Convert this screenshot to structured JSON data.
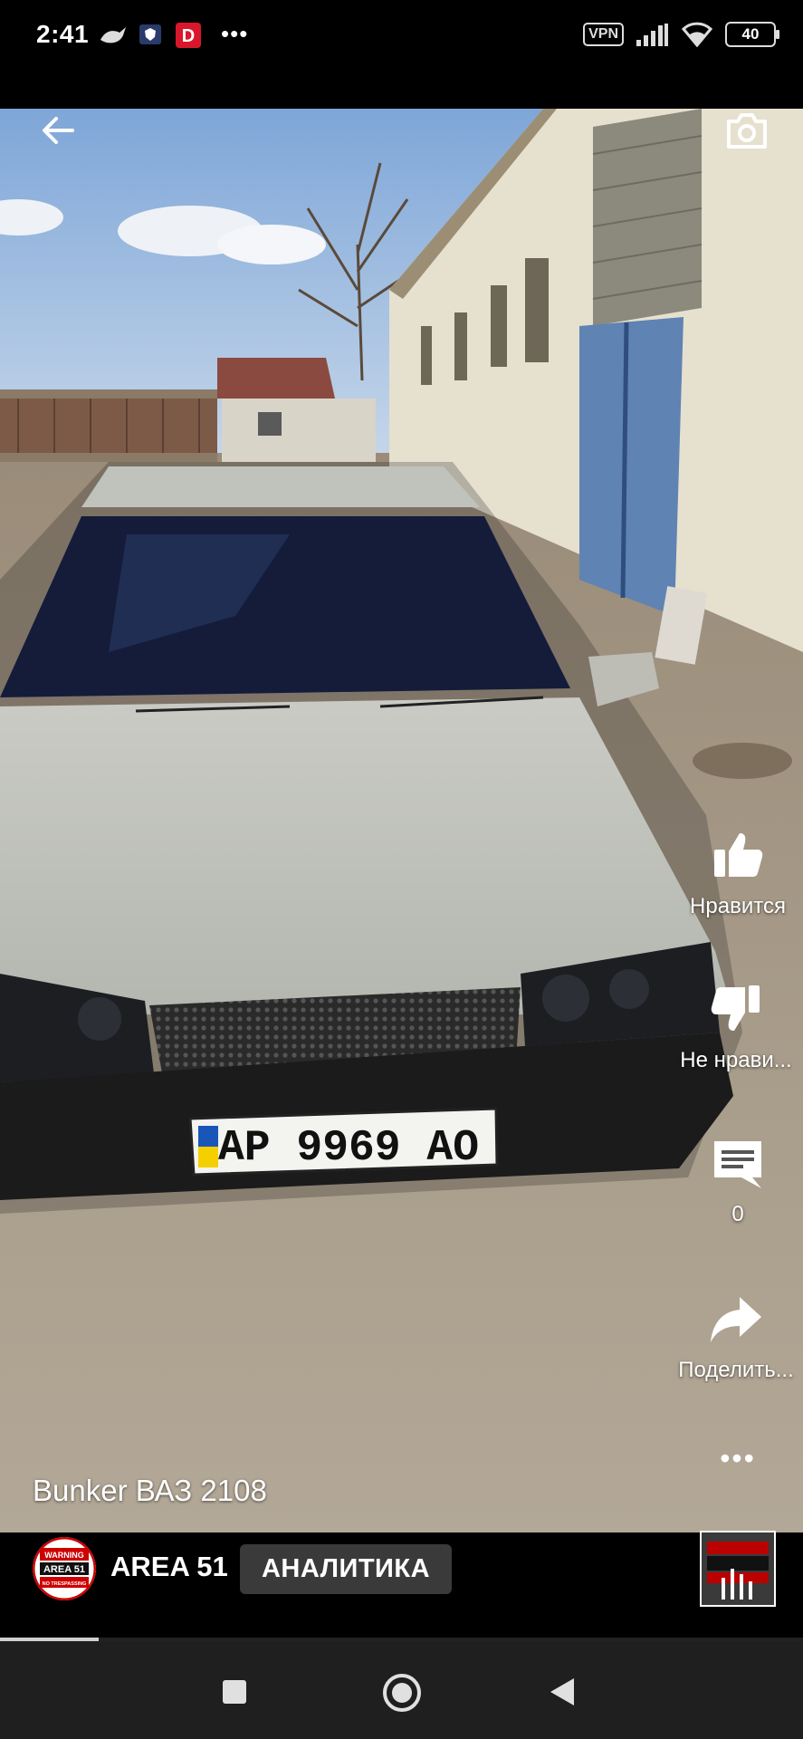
{
  "status_bar": {
    "time": "2:41",
    "vpn": "VPN",
    "battery": "40",
    "more": "•••"
  },
  "video": {
    "caption": "Bunker ВАЗ 2108",
    "plate": "AP 9969 AO",
    "plate_country": "UA"
  },
  "actions": {
    "like_label": "Нравится",
    "dislike_label": "Не нрави...",
    "comments_count": "0",
    "share_label": "Поделить...",
    "more": "•••"
  },
  "channel": {
    "name": "AREA 51",
    "analytics_label": "АНАЛИТИКА",
    "avatar_text_top": "WARNING",
    "avatar_text_main": "AREA 51",
    "avatar_text_bottom": "NO TRESPASSING"
  },
  "playback": {
    "progress_fraction": 0.123
  },
  "colors": {
    "accent": "#3a3a3a",
    "plate_blue": "#1a56b8",
    "plate_yellow": "#f5d000"
  }
}
